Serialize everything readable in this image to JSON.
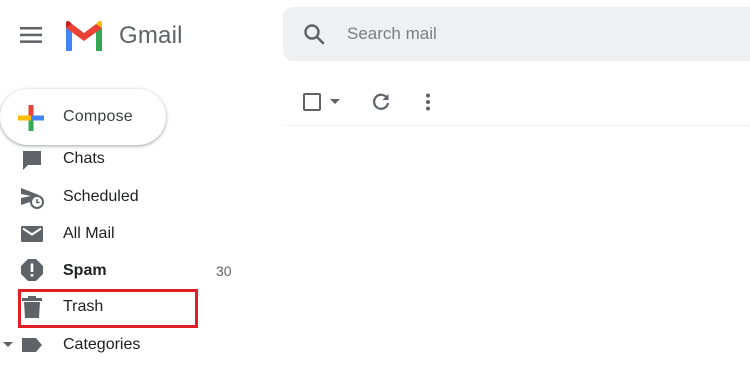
{
  "app": {
    "logo_text": "Gmail"
  },
  "search": {
    "placeholder": "Search mail"
  },
  "compose": {
    "label": "Compose"
  },
  "nav": {
    "items": [
      {
        "label": "Chats",
        "icon": "chat-icon"
      },
      {
        "label": "Scheduled",
        "icon": "scheduled-send-icon"
      },
      {
        "label": "All Mail",
        "icon": "mail-icon"
      },
      {
        "label": "Spam",
        "icon": "spam-icon",
        "count": "30"
      },
      {
        "label": "Trash",
        "icon": "trash-icon"
      },
      {
        "label": "Categories",
        "icon": "label-icon"
      }
    ]
  },
  "colors": {
    "highlight": "#e11d25",
    "icon_gray": "#5f6368",
    "search_bg": "#eef0f2"
  }
}
